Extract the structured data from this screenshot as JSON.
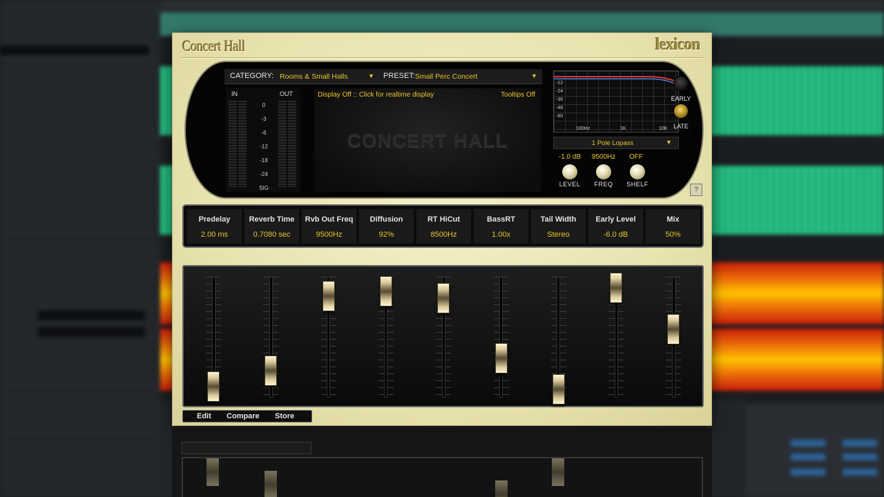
{
  "plugin": {
    "title": "Concert Hall",
    "brand": "lexicon"
  },
  "browser": {
    "category_label": "CATEGORY:",
    "category_value": "Rooms & Small Halls",
    "preset_label": "PRESET:",
    "preset_value": "Small Perc Concert"
  },
  "meters": {
    "in_label": "IN",
    "out_label": "OUT",
    "scale": [
      "0",
      "-3",
      "-6",
      "-12",
      "-18",
      "-24",
      "SIG"
    ]
  },
  "display": {
    "info": "Display Off :: Click for realtime display",
    "tooltips": "Tooltips Off",
    "name": "CONCERT HALL"
  },
  "eq": {
    "y_labels": [
      "-12",
      "-24",
      "-36",
      "-48",
      "-60"
    ],
    "x_labels": [
      "100Hz",
      "1K",
      "10K"
    ],
    "filter_type": "1 Pole Lopass",
    "level_value": "-1.0 dB",
    "freq_value": "9500Hz",
    "shelf_value": "OFF",
    "level_label": "LEVEL",
    "freq_label": "FREQ",
    "shelf_label": "SHELF"
  },
  "reflections": {
    "early_label": "EARLY",
    "late_label": "LATE",
    "selected": "LATE"
  },
  "help": "?",
  "params": [
    {
      "name": "Predelay",
      "value": "2.00 ms"
    },
    {
      "name": "Reverb Time",
      "value": "0.7080 sec"
    },
    {
      "name": "Rvb Out Freq",
      "value": "9500Hz"
    },
    {
      "name": "Diffusion",
      "value": "92%"
    },
    {
      "name": "RT HiCut",
      "value": "8500Hz"
    },
    {
      "name": "BassRT",
      "value": "1.00x"
    },
    {
      "name": "Tail Width",
      "value": "Stereo"
    },
    {
      "name": "Early Level",
      "value": "-6.0 dB"
    },
    {
      "name": "Mix",
      "value": "50%"
    }
  ],
  "fader_levels": [
    0.05,
    0.2,
    0.92,
    0.97,
    0.9,
    0.32,
    0.02,
    1.0,
    0.6
  ],
  "bottom_bar": {
    "edit": "Edit",
    "compare": "Compare",
    "store": "Store"
  },
  "colors": {
    "accent_yellow": "#e9c62e",
    "panel_cream": "#eee8be"
  }
}
